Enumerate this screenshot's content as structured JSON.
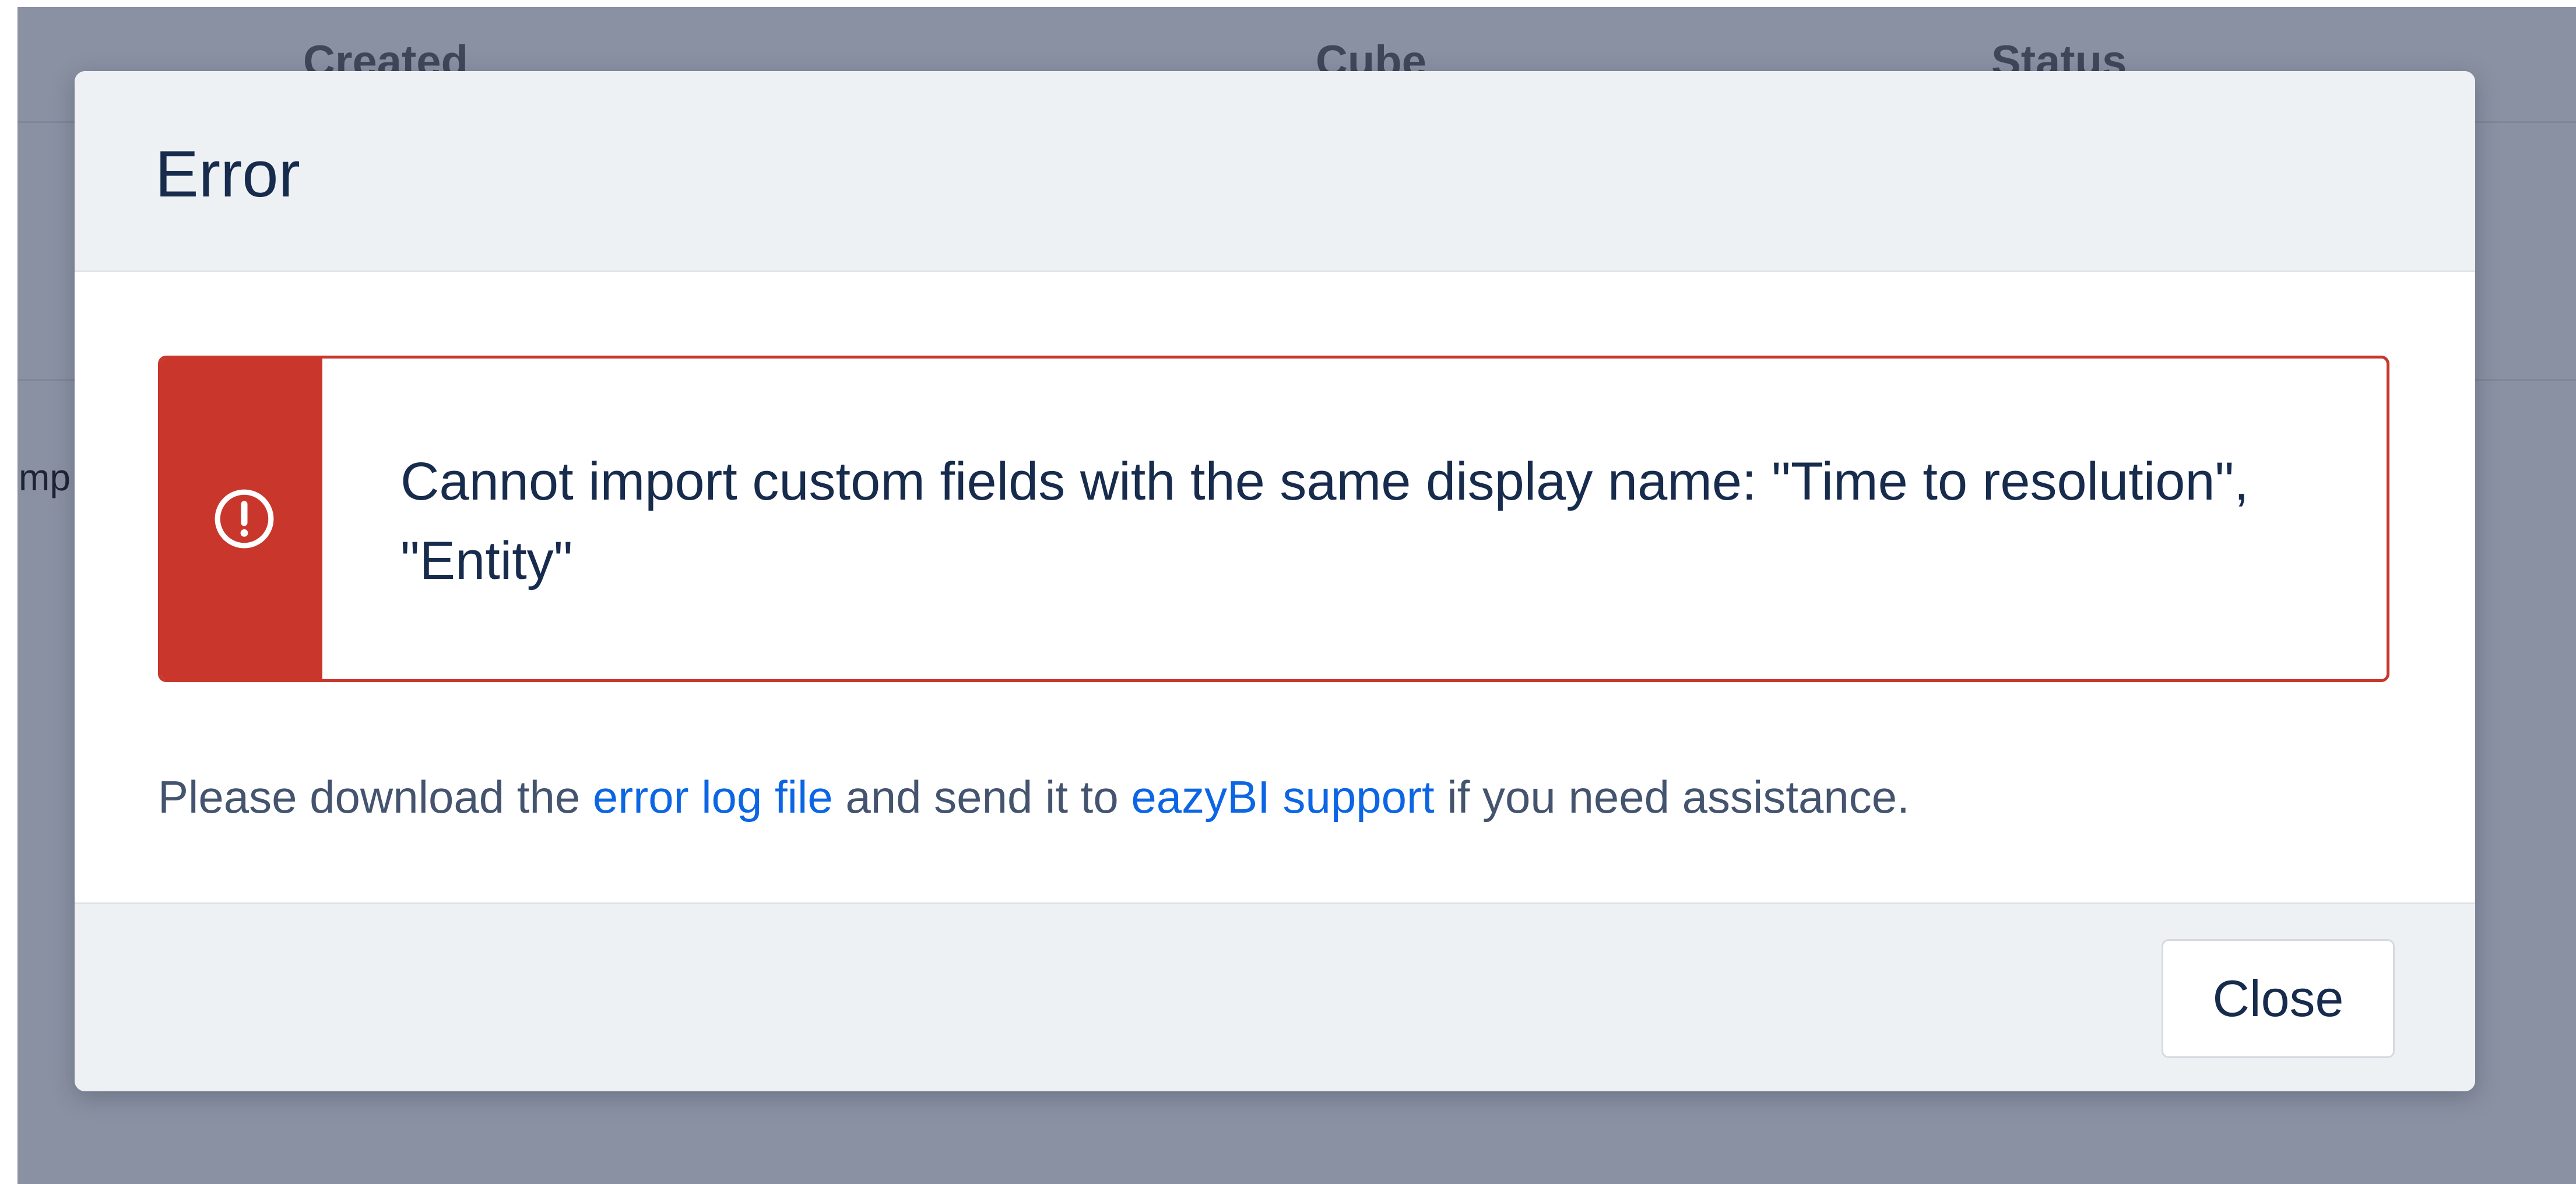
{
  "background": {
    "table_headers": [
      "Created",
      "Cube",
      "Status"
    ],
    "row_fragment": "mp"
  },
  "modal": {
    "title": "Error",
    "alert": {
      "icon": "exclamation-circle-icon",
      "message": "Cannot import custom fields with the same display name: \"Time to resolution\", \"Entity\""
    },
    "help": {
      "prefix": "Please download the ",
      "error_log_link": "error log file",
      "middle": " and send it to ",
      "support_link": "eazyBI support",
      "suffix": " if you need assistance."
    },
    "close_label": "Close"
  },
  "colors": {
    "backdrop": "#8a91a3",
    "danger": "#c9372c",
    "link": "#0c66e4",
    "text_primary": "#172b4d",
    "text_secondary": "#44546f"
  }
}
